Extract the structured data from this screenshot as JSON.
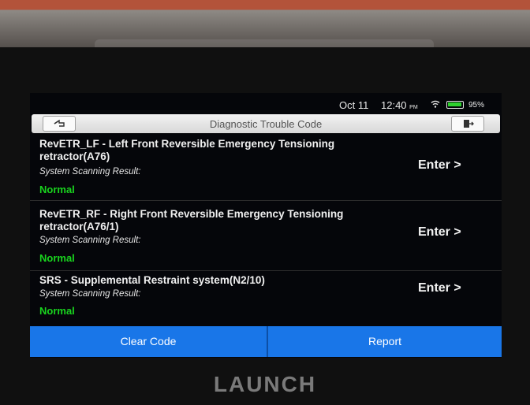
{
  "status_bar": {
    "date": "Oct 11",
    "time": "12:40",
    "ampm": "PM",
    "battery": "95%"
  },
  "header": {
    "title": "Diagnostic Trouble Code"
  },
  "items": [
    {
      "name": "RevETR_LF - Left Front Reversible Emergency Tensioning retractor(A76)",
      "scan_label": "System Scanning Result:",
      "result": "Normal",
      "action": "Enter >"
    },
    {
      "name": "RevETR_RF - Right Front Reversible Emergency Tensioning retractor(A76/1)",
      "scan_label": "System Scanning Result:",
      "result": "Normal",
      "action": "Enter >"
    },
    {
      "name": "SRS - Supplemental Restraint system(N2/10)",
      "scan_label": "System Scanning Result:",
      "result": "Normal",
      "action": "Enter >"
    }
  ],
  "buttons": {
    "clear": "Clear Code",
    "report": "Report"
  },
  "brand": "LAUNCH",
  "colors": {
    "accent": "#1976e8",
    "normal": "#19d41e"
  }
}
